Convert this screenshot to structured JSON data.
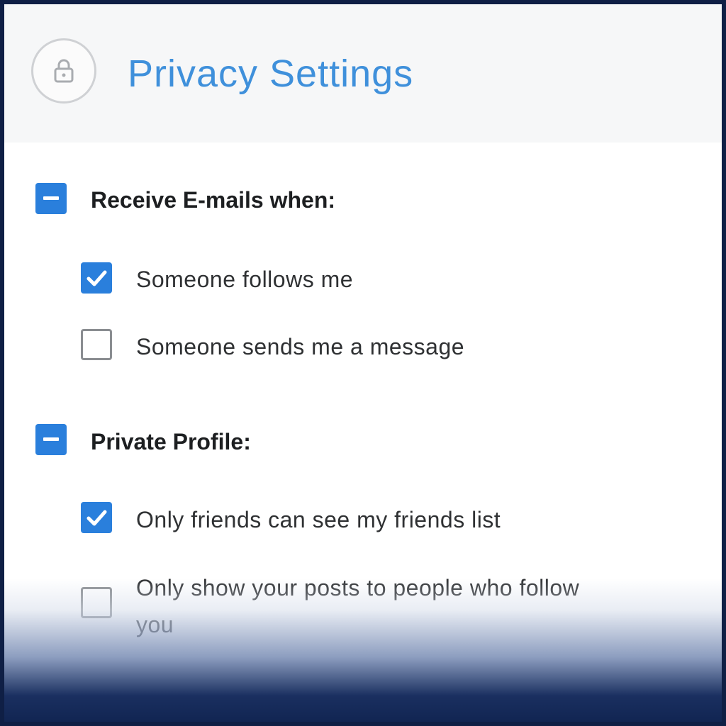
{
  "header": {
    "title": "Privacy Settings",
    "icon": "lock-icon"
  },
  "groups": [
    {
      "label": "Receive E-mails when:",
      "state": "indeterminate",
      "items": [
        {
          "label": "Someone follows me",
          "checked": true
        },
        {
          "label": "Someone sends me a message",
          "checked": false
        }
      ]
    },
    {
      "label": "Private Profile:",
      "state": "indeterminate",
      "items": [
        {
          "label": "Only friends can see my friends list",
          "checked": true
        },
        {
          "label": "Only show your posts to people who follow you",
          "checked": false
        }
      ]
    }
  ],
  "colors": {
    "accent": "#2a7fdc",
    "title": "#3f90db",
    "frame": "#0f1f45"
  }
}
